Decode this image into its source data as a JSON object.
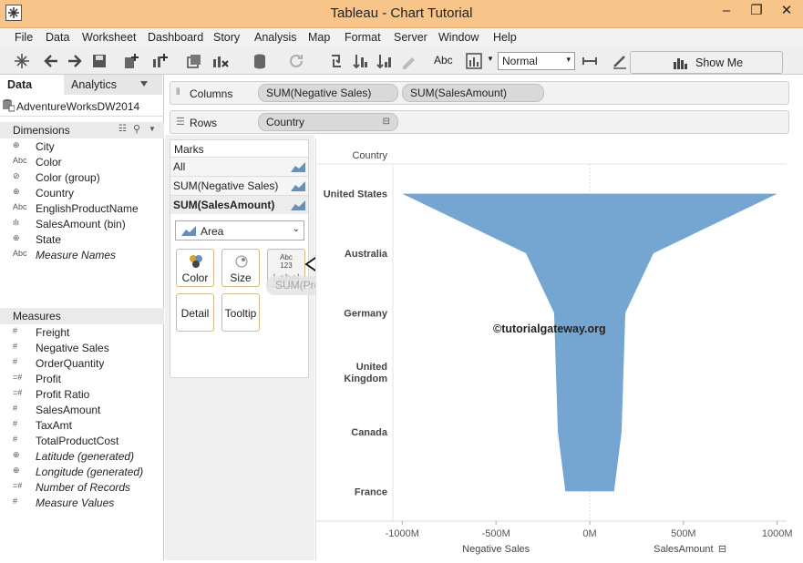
{
  "window": {
    "title": "Tableau - Chart Tutorial",
    "minimize": "–",
    "restore": "❐",
    "close": "✕"
  },
  "menu": [
    "File",
    "Data",
    "Worksheet",
    "Dashboard",
    "Story",
    "Analysis",
    "Map",
    "Format",
    "Server",
    "Window",
    "Help"
  ],
  "toolbar": {
    "fit_value": "Normal",
    "text_icon": "Abc",
    "show_me": "Show Me"
  },
  "datapane": {
    "tabs": [
      "Data",
      "Analytics"
    ],
    "datasource": "AdventureWorksDW2014",
    "dimensions_header": "Dimensions",
    "dimensions": [
      {
        "icon": "⊕",
        "label": "City",
        "italic": false
      },
      {
        "icon": "Abc",
        "label": "Color",
        "italic": false
      },
      {
        "icon": "⊘",
        "label": "Color (group)",
        "italic": false
      },
      {
        "icon": "⊕",
        "label": "Country",
        "italic": false
      },
      {
        "icon": "Abc",
        "label": "EnglishProductName",
        "italic": false
      },
      {
        "icon": "ılı",
        "label": "SalesAmount (bin)",
        "italic": false
      },
      {
        "icon": "⊕",
        "label": "State",
        "italic": false
      },
      {
        "icon": "Abc",
        "label": "Measure Names",
        "italic": true
      }
    ],
    "measures_header": "Measures",
    "measures": [
      {
        "icon": "#",
        "label": "Freight",
        "italic": false
      },
      {
        "icon": "#",
        "label": "Negative Sales",
        "italic": false
      },
      {
        "icon": "#",
        "label": "OrderQuantity",
        "italic": false
      },
      {
        "icon": "=#",
        "label": "Profit",
        "italic": false
      },
      {
        "icon": "=#",
        "label": "Profit Ratio",
        "italic": false
      },
      {
        "icon": "#",
        "label": "SalesAmount",
        "italic": false
      },
      {
        "icon": "#",
        "label": "TaxAmt",
        "italic": false
      },
      {
        "icon": "#",
        "label": "TotalProductCost",
        "italic": false
      },
      {
        "icon": "⊕",
        "label": "Latitude (generated)",
        "italic": true
      },
      {
        "icon": "⊕",
        "label": "Longitude (generated)",
        "italic": true
      },
      {
        "icon": "=#",
        "label": "Number of Records",
        "italic": true
      },
      {
        "icon": "#",
        "label": "Measure Values",
        "italic": true
      }
    ]
  },
  "shelves": {
    "columns_label": "Columns",
    "columns_pills": [
      "SUM(Negative Sales)",
      "SUM(SalesAmount)"
    ],
    "rows_label": "Rows",
    "rows_pills": [
      "Country"
    ]
  },
  "marks": {
    "header": "Marks",
    "rows": [
      "All",
      "SUM(Negative Sales)",
      "SUM(SalesAmount)"
    ],
    "mark_type": "Area",
    "buttons": {
      "color": "Color",
      "size": "Size",
      "label": "Label",
      "label_icon": "Abc\n123",
      "detail": "Detail",
      "tooltip": "Tooltip"
    },
    "drag_pill": "SUM(Profit)"
  },
  "chart_data": {
    "type": "area",
    "row_header": "Country",
    "categories": [
      "United States",
      "Australia",
      "Germany",
      "United\nKingdom",
      "Canada",
      "France"
    ],
    "series": [
      {
        "name": "Negative Sales",
        "values": [
          -1000,
          -340,
          -190,
          -180,
          -170,
          -130
        ]
      },
      {
        "name": "SalesAmount",
        "values": [
          1000,
          340,
          190,
          180,
          170,
          130
        ]
      }
    ],
    "x_ticks": [
      "-1000M",
      "-500M",
      "0M",
      "500M",
      "1000M"
    ],
    "x_tick_values": [
      -1000,
      -500,
      0,
      500,
      1000
    ],
    "xlim": [
      -1050,
      1050
    ],
    "xlabels": [
      "Negative Sales",
      "SalesAmount"
    ],
    "watermark": "©tutorialgateway.org",
    "fill_color": "#75a6d1"
  }
}
